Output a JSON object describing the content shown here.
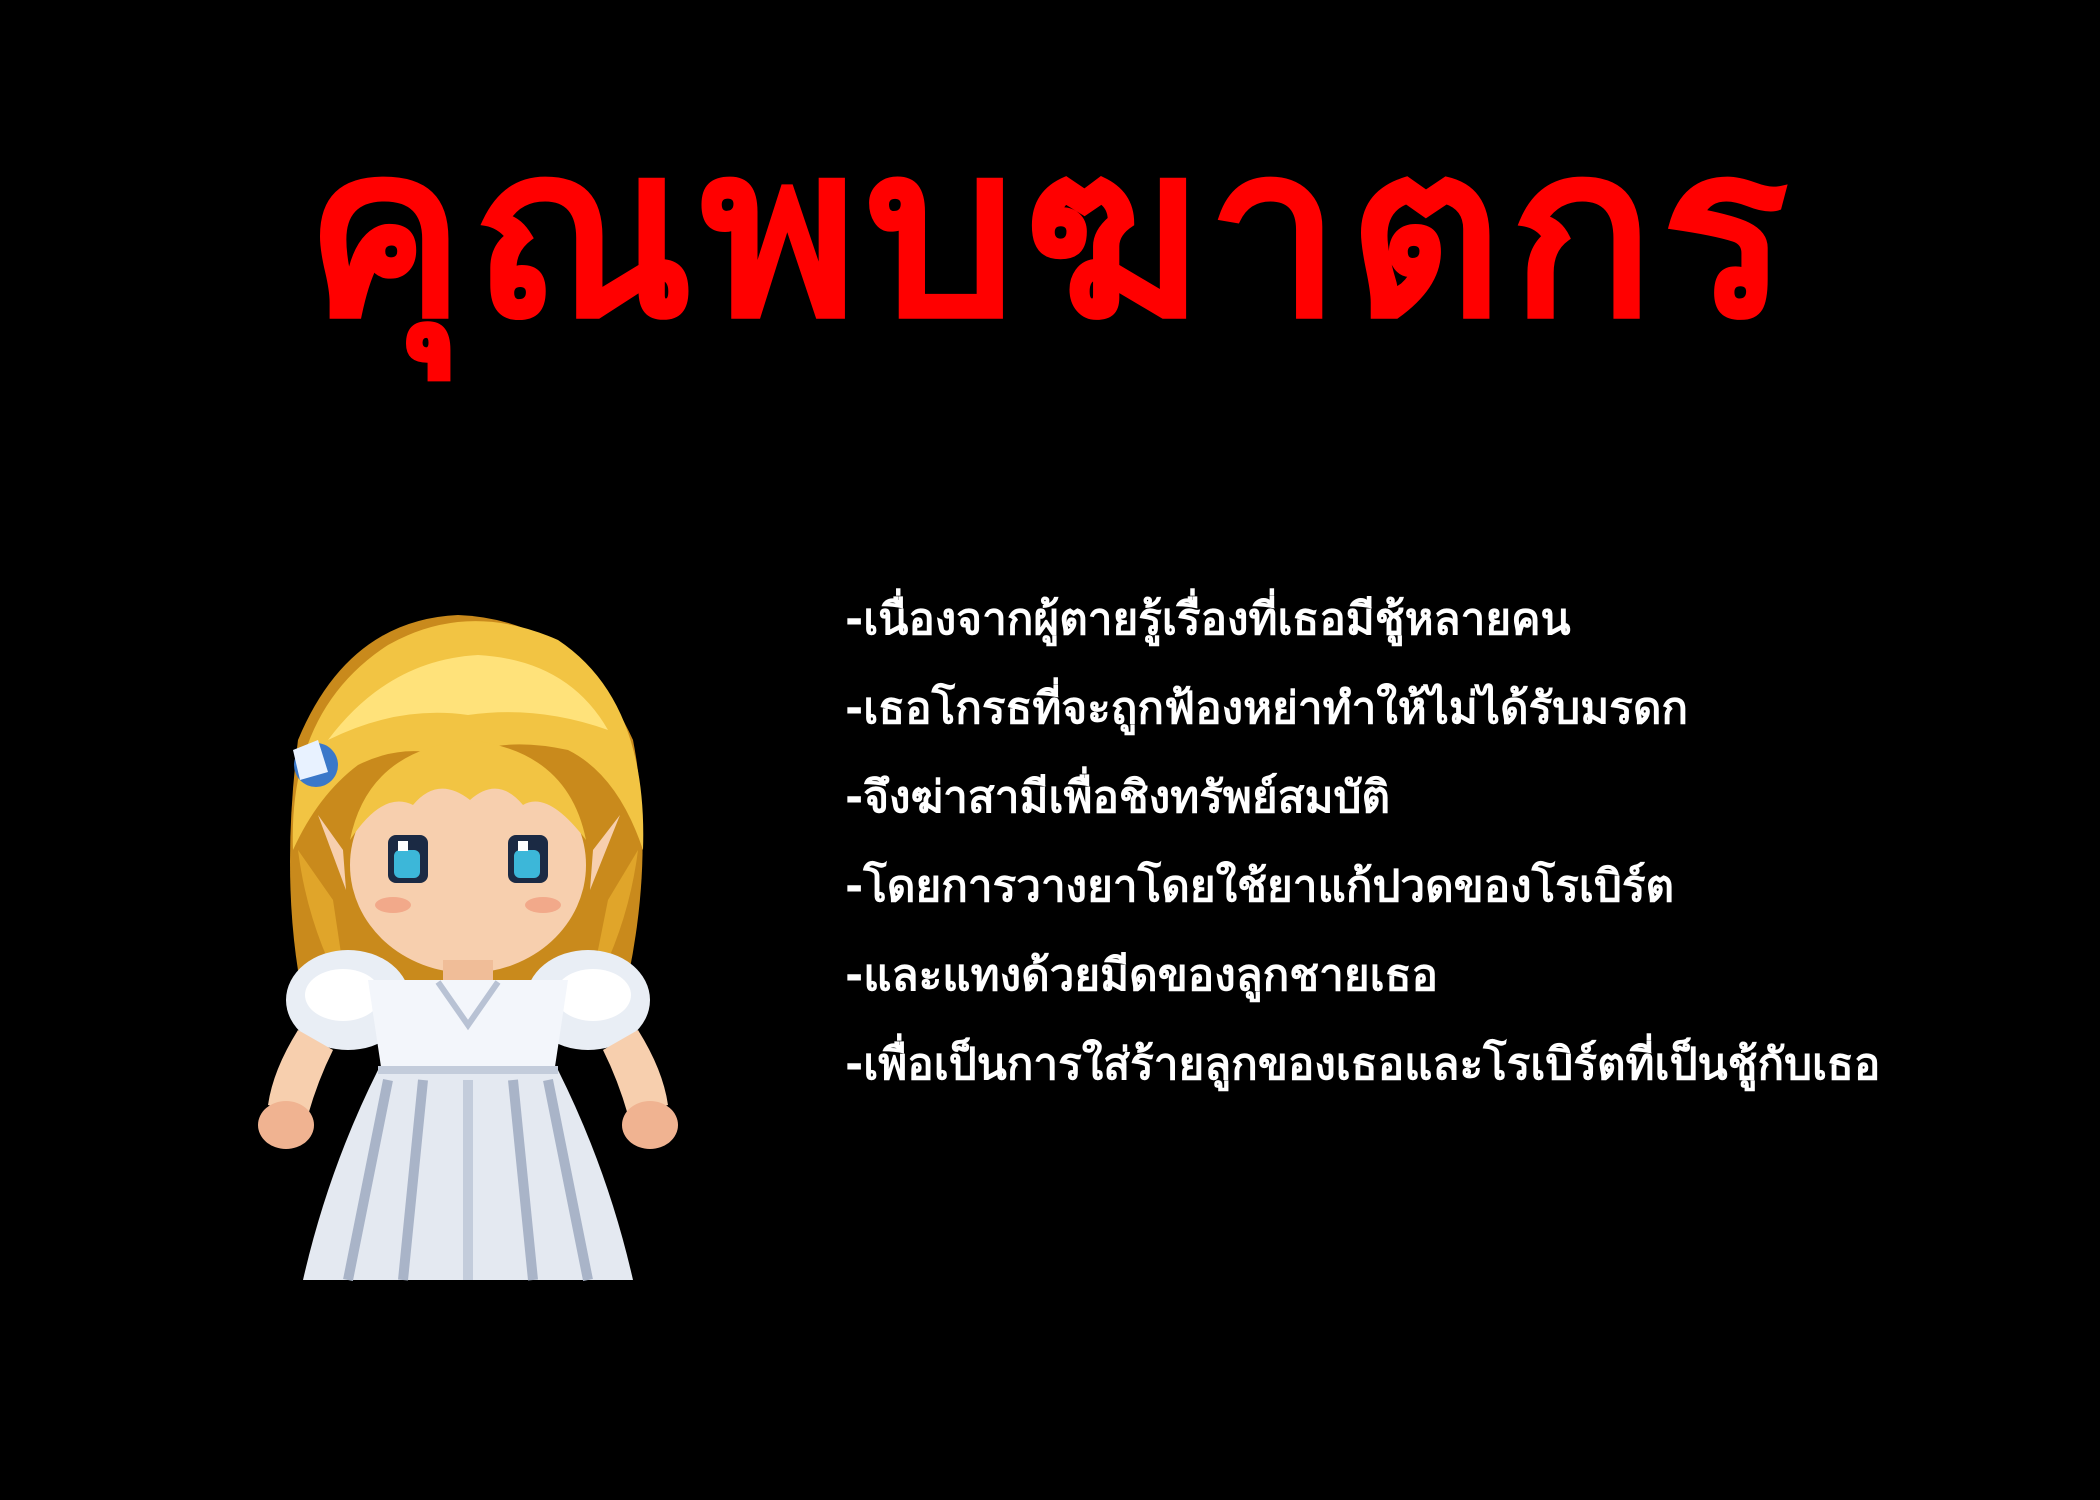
{
  "screen": {
    "title": "คุณพบฆาตกร",
    "title_color": "#ff0000",
    "background_color": "#000000",
    "text_color": "#ffffff",
    "character": {
      "icon": "blonde-girl-white-dress-sprite"
    },
    "clues": [
      "-เนื่องจากผู้ตายรู้เรื่องที่เธอมีชู้หลายคน",
      "-เธอโกรธที่จะถูกฟ้องหย่าทำให้ไม่ได้รับมรดก",
      "-จึงฆ่าสามีเพื่อชิงทรัพย์สมบัติ",
      "-โดยการวางยาโดยใช้ยาแก้ปวดของโรเบิร์ต",
      "-และแทงด้วยมีดของลูกชายเธอ",
      "-เพื่อเป็นการใส่ร้ายลูกของเธอและโรเบิร์ตที่เป็นชู้กับเธอ"
    ]
  }
}
